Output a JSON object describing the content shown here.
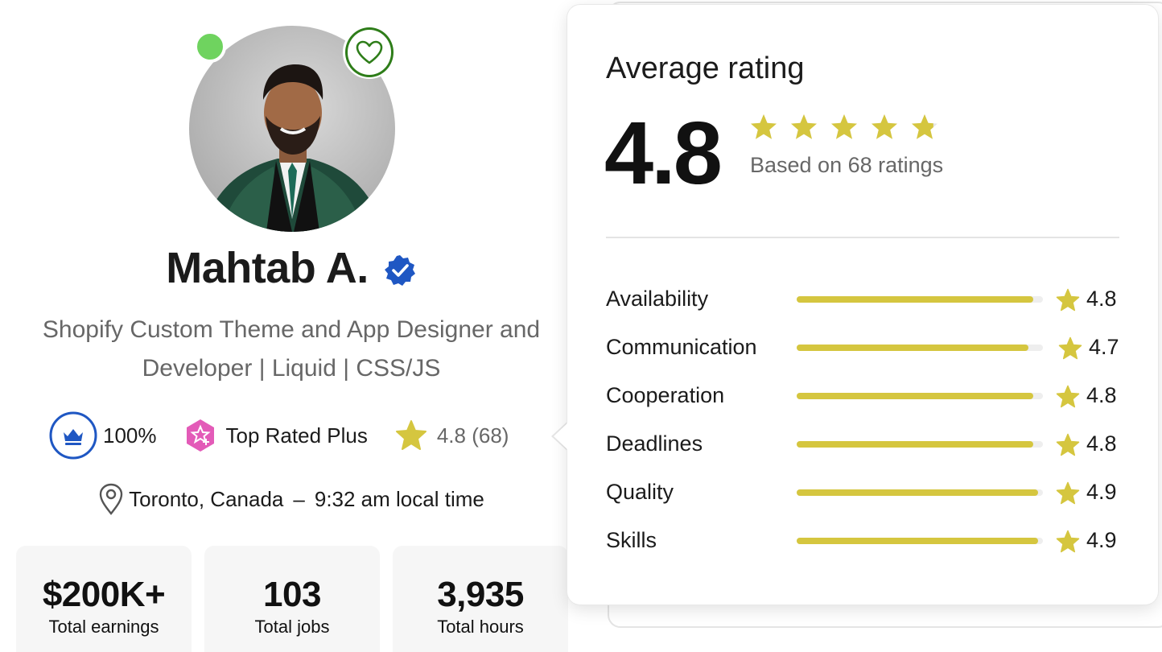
{
  "profile": {
    "name": "Mahtab A.",
    "headline_line1": "Shopify Custom Theme and App Designer and",
    "headline_line2": "Developer | Liquid | CSS/JS",
    "status": "online",
    "is_verified": true,
    "is_favorited": false
  },
  "badges": {
    "job_success": "100%",
    "job_success_fraction": 1.0,
    "top_rated_label": "Top Rated Plus",
    "rating_score": "4.8",
    "rating_count": "(68)"
  },
  "location": {
    "city": "Toronto, Canada",
    "separator": "–",
    "local_time": "9:32 am local time"
  },
  "stats": [
    {
      "value": "$200K+",
      "label": "Total earnings"
    },
    {
      "value": "103",
      "label": "Total jobs"
    },
    {
      "value": "3,935",
      "label": "Total hours"
    }
  ],
  "rating_popover": {
    "title": "Average rating",
    "score": "4.8",
    "stars_filled": 4.8,
    "based_on": "Based on 68 ratings",
    "categories": [
      {
        "label": "Availability",
        "score": "4.8",
        "value": 4.8
      },
      {
        "label": "Communication",
        "score": "4.7",
        "value": 4.7
      },
      {
        "label": "Cooperation",
        "score": "4.8",
        "value": 4.8
      },
      {
        "label": "Deadlines",
        "score": "4.8",
        "value": 4.8
      },
      {
        "label": "Quality",
        "score": "4.9",
        "value": 4.9
      },
      {
        "label": "Skills",
        "score": "4.9",
        "value": 4.9
      }
    ]
  },
  "colors": {
    "star": "#d5c63f",
    "online": "#6fd35f",
    "favorite_ring": "#2e7d19",
    "verified": "#1f57c3",
    "job_success_ring": "#1f57c3",
    "top_rated": "#e35bb8"
  },
  "icons": {
    "favorite": "heart-icon",
    "verified": "verified-badge-icon",
    "job_success": "crown-icon",
    "top_rated": "top-rated-plus-icon",
    "rating": "star-icon",
    "location": "location-pin-icon"
  }
}
